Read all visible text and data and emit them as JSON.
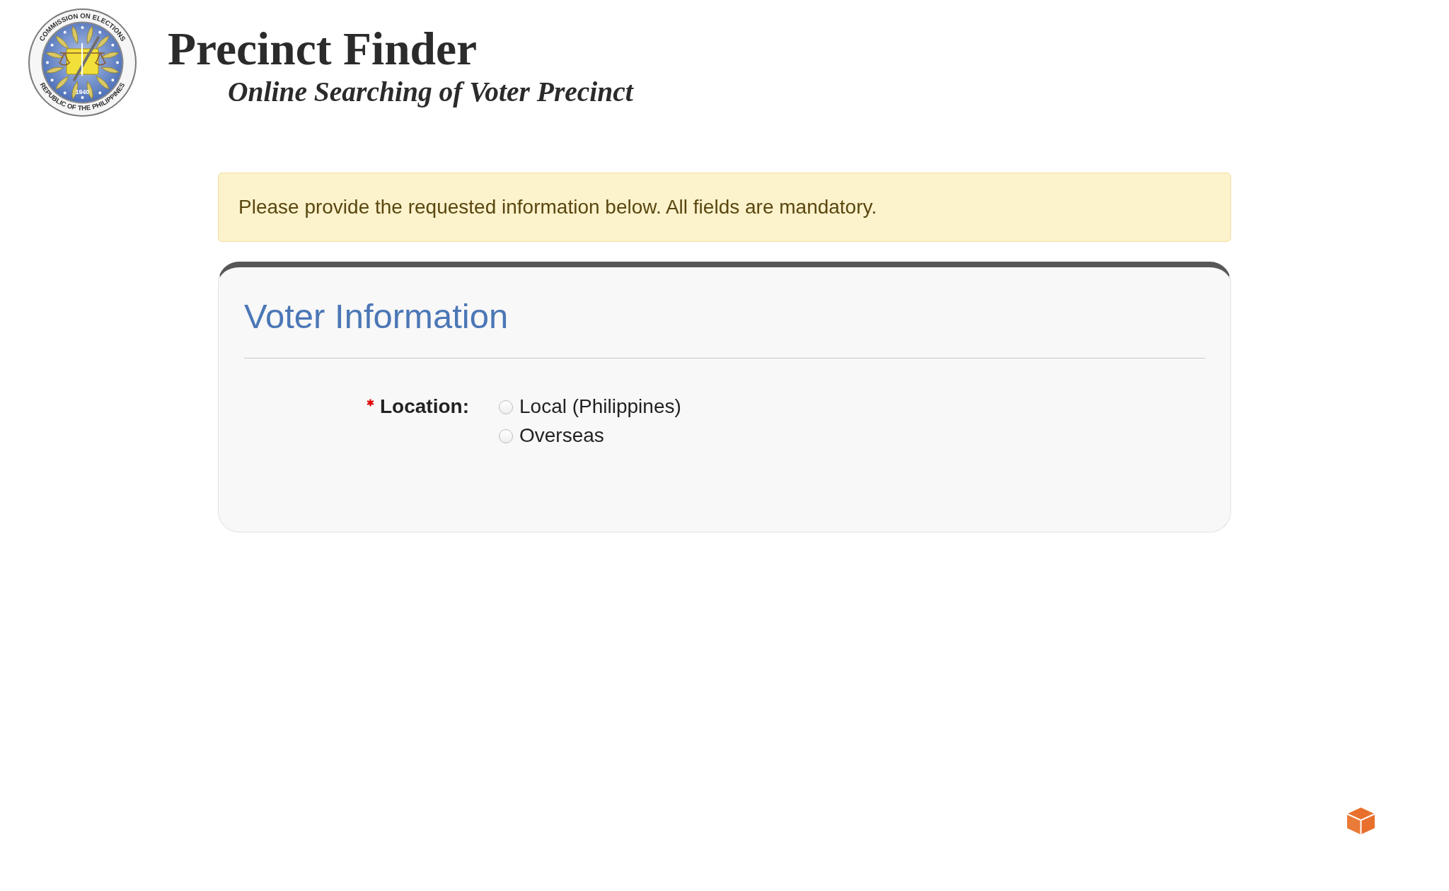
{
  "header": {
    "logo": {
      "top_text": "COMMISSION ON ELECTIONS",
      "bottom_text": "REPUBLIC OF THE PHILIPPINES",
      "year": "1940"
    },
    "title": "Precinct Finder",
    "subtitle": "Online Searching of Voter Precinct"
  },
  "alert": {
    "message": "Please provide the requested information below. All fields are mandatory."
  },
  "panel": {
    "title": "Voter Information",
    "fields": [
      {
        "label": "Location:",
        "required": true,
        "options": [
          {
            "label": "Local (Philippines)",
            "selected": false
          },
          {
            "label": "Overseas",
            "selected": false
          }
        ]
      }
    ]
  }
}
